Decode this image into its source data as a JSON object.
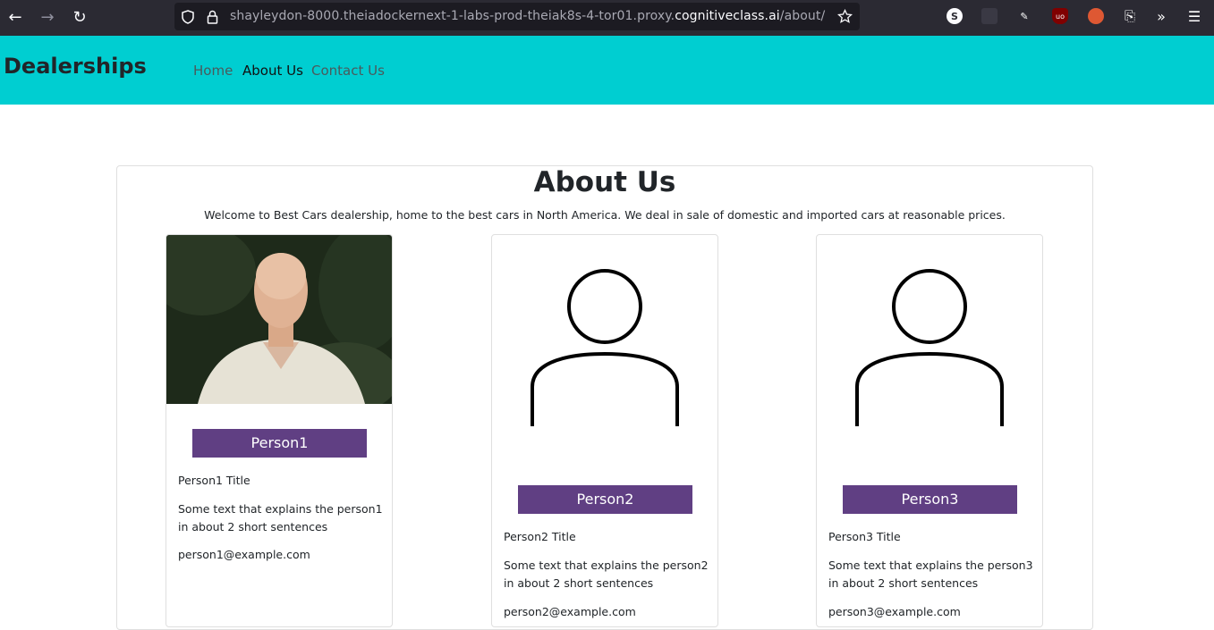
{
  "browser": {
    "url_prefix": "shayleydon-8000.theiadockernext-1-labs-prod-theiak8s-4-tor01.proxy.",
    "url_domain": "cognitiveclass.ai",
    "url_path": "/about/",
    "icons": [
      "back-icon",
      "forward-icon",
      "reload-icon",
      "shield-icon",
      "lock-icon",
      "star-icon",
      "extensions-icon",
      "overflow-icon",
      "menu-icon"
    ]
  },
  "navbar": {
    "brand": "Dealerships",
    "links": [
      {
        "label": "Home"
      },
      {
        "label": "About Us"
      },
      {
        "label": "Contact Us"
      }
    ],
    "bg_color": "#00ced1"
  },
  "about": {
    "title": "About Us",
    "intro": "Welcome to Best Cars dealership, home to the best cars in North America. We deal in sale of domestic and imported cars at reasonable prices."
  },
  "people": [
    {
      "name": "Person1",
      "title": "Person1 Title",
      "desc": "Some text that explains the person1 in about 2 short sentences",
      "email": "person1@example.com"
    },
    {
      "name": "Person2",
      "title": "Person2 Title",
      "desc": "Some text that explains the person2 in about 2 short sentences",
      "email": "person2@example.com"
    },
    {
      "name": "Person3",
      "title": "Person3 Title",
      "desc": "Some text that explains the person3 in about 2 short sentences",
      "email": "person3@example.com"
    }
  ],
  "colors": {
    "badge": "#603f83",
    "navbar": "#00ced1",
    "chrome": "#2b2a33"
  }
}
